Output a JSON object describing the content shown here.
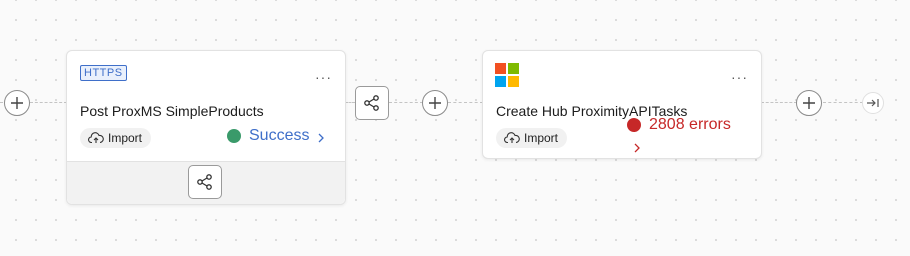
{
  "nodes": {
    "first": {
      "badge": "HTTPS",
      "title": "Post ProxMS SimpleProducts",
      "import_label": "Import",
      "status_text": "Success",
      "status_color": "#3a9a6a",
      "status_text_color": "#3f6fc9",
      "more": "···"
    },
    "second": {
      "icon": "microsoft-logo-icon",
      "title": "Create Hub ProximityAPITasks",
      "import_label": "Import",
      "status_text": "2808 errors",
      "status_color": "#c62828",
      "status_text_color": "#c62828",
      "more": "···"
    }
  },
  "icons": {
    "add": "plus-icon",
    "branch": "branch-icon",
    "end": "flow-end-icon",
    "import": "cloud-upload-icon",
    "chevron": "chevron-right-icon"
  },
  "colors": {
    "accent_blue": "#3f6fc9",
    "success_green": "#3a9a6a",
    "error_red": "#c62828"
  }
}
